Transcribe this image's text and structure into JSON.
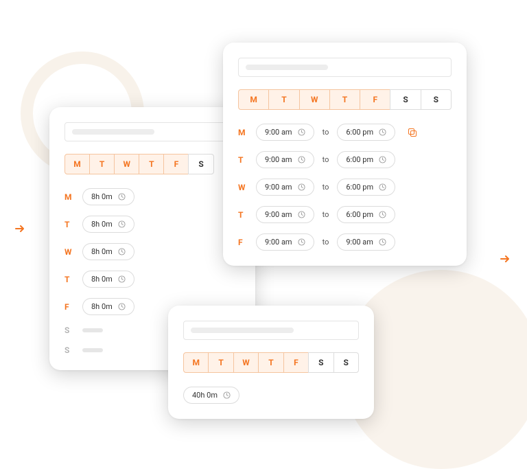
{
  "colors": {
    "accent": "#F47521"
  },
  "days": [
    "M",
    "T",
    "W",
    "T",
    "F",
    "S",
    "S"
  ],
  "leftCard": {
    "days": [
      {
        "label": "M",
        "selected": true
      },
      {
        "label": "T",
        "selected": true
      },
      {
        "label": "W",
        "selected": true
      },
      {
        "label": "T",
        "selected": true
      },
      {
        "label": "F",
        "selected": true
      },
      {
        "label": "S",
        "selected": false
      }
    ],
    "rows": [
      {
        "day": "M",
        "value": "8h 0m",
        "active": true
      },
      {
        "day": "T",
        "value": "8h 0m",
        "active": true
      },
      {
        "day": "W",
        "value": "8h 0m",
        "active": true
      },
      {
        "day": "T",
        "value": "8h 0m",
        "active": true
      },
      {
        "day": "F",
        "value": "8h 0m",
        "active": true
      },
      {
        "day": "S",
        "value": "",
        "active": false
      },
      {
        "day": "S",
        "value": "",
        "active": false
      }
    ]
  },
  "rightCard": {
    "days": [
      {
        "label": "M",
        "selected": true
      },
      {
        "label": "T",
        "selected": true
      },
      {
        "label": "W",
        "selected": true
      },
      {
        "label": "T",
        "selected": true
      },
      {
        "label": "F",
        "selected": true
      },
      {
        "label": "S",
        "selected": false
      },
      {
        "label": "S",
        "selected": false
      }
    ],
    "to_label": "to",
    "rows": [
      {
        "day": "M",
        "start": "9:00 am",
        "end": "6:00 pm",
        "copy": true
      },
      {
        "day": "T",
        "start": "9:00 am",
        "end": "6:00 pm",
        "copy": false
      },
      {
        "day": "W",
        "start": "9:00 am",
        "end": "6:00 pm",
        "copy": false
      },
      {
        "day": "T",
        "start": "9:00 am",
        "end": "6:00 pm",
        "copy": false
      },
      {
        "day": "F",
        "start": "9:00 am",
        "end": "9:00 am",
        "copy": false
      }
    ]
  },
  "bottomCard": {
    "days": [
      {
        "label": "M",
        "selected": true
      },
      {
        "label": "T",
        "selected": true
      },
      {
        "label": "W",
        "selected": true
      },
      {
        "label": "T",
        "selected": true
      },
      {
        "label": "F",
        "selected": true
      },
      {
        "label": "S",
        "selected": false
      },
      {
        "label": "S",
        "selected": false
      }
    ],
    "total": "40h 0m"
  }
}
